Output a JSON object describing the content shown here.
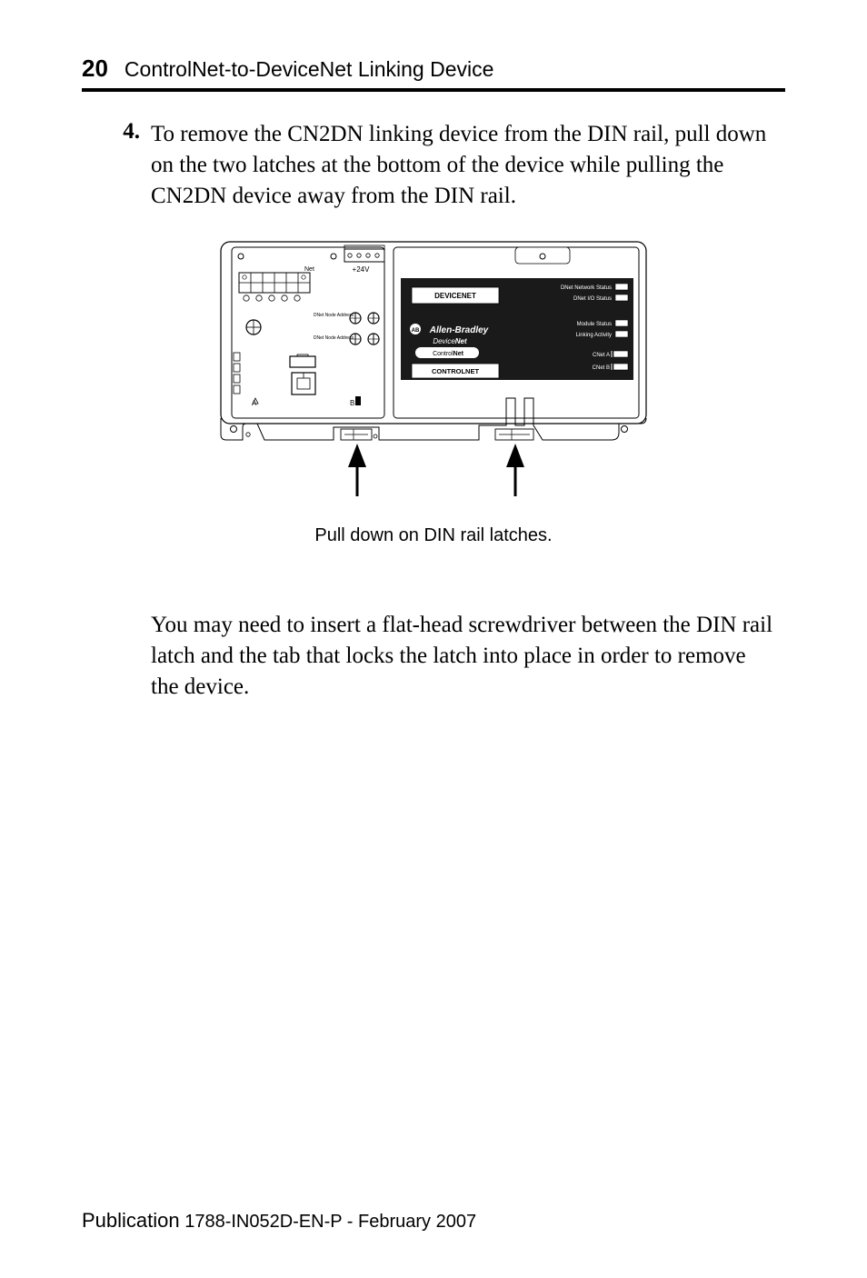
{
  "header": {
    "page_number": "20",
    "title": "ControlNet-to-DeviceNet Linking Device"
  },
  "step": {
    "number": "4.",
    "text": "To remove the CN2DN linking device from the DIN rail, pull down on the two latches at the bottom of the device while pulling the CN2DN device away from the DIN rail."
  },
  "figure": {
    "caption": "Pull down on DIN rail latches.",
    "labels": {
      "devicenet": "DEVICENET",
      "controlnet": "CONTROLNET",
      "allen_bradley": "Allen-Bradley",
      "devicenet_logo": "DeviceNet",
      "controlnet_logo": "ControlNet",
      "v24": "+24V",
      "net": "Net",
      "dnet_network_status": "DNet Network Status",
      "dnet_io_status": "DNet I/O Status",
      "module_status": "Module Status",
      "linking_activity": "Linking Activity",
      "cnet_a": "CNet A",
      "cnet_b": "CNet B",
      "dnet_node_top": "DNet Node Address",
      "dnet_node_bot": "DNet Node Address",
      "a": "A",
      "b": "B"
    }
  },
  "followup": "You may need to insert a flat-head screwdriver between the DIN rail latch and the tab that locks the latch into place in order to remove the device.",
  "publication": {
    "prefix": "Publication",
    "code": "1788-IN052D-EN-P - February 2007"
  }
}
